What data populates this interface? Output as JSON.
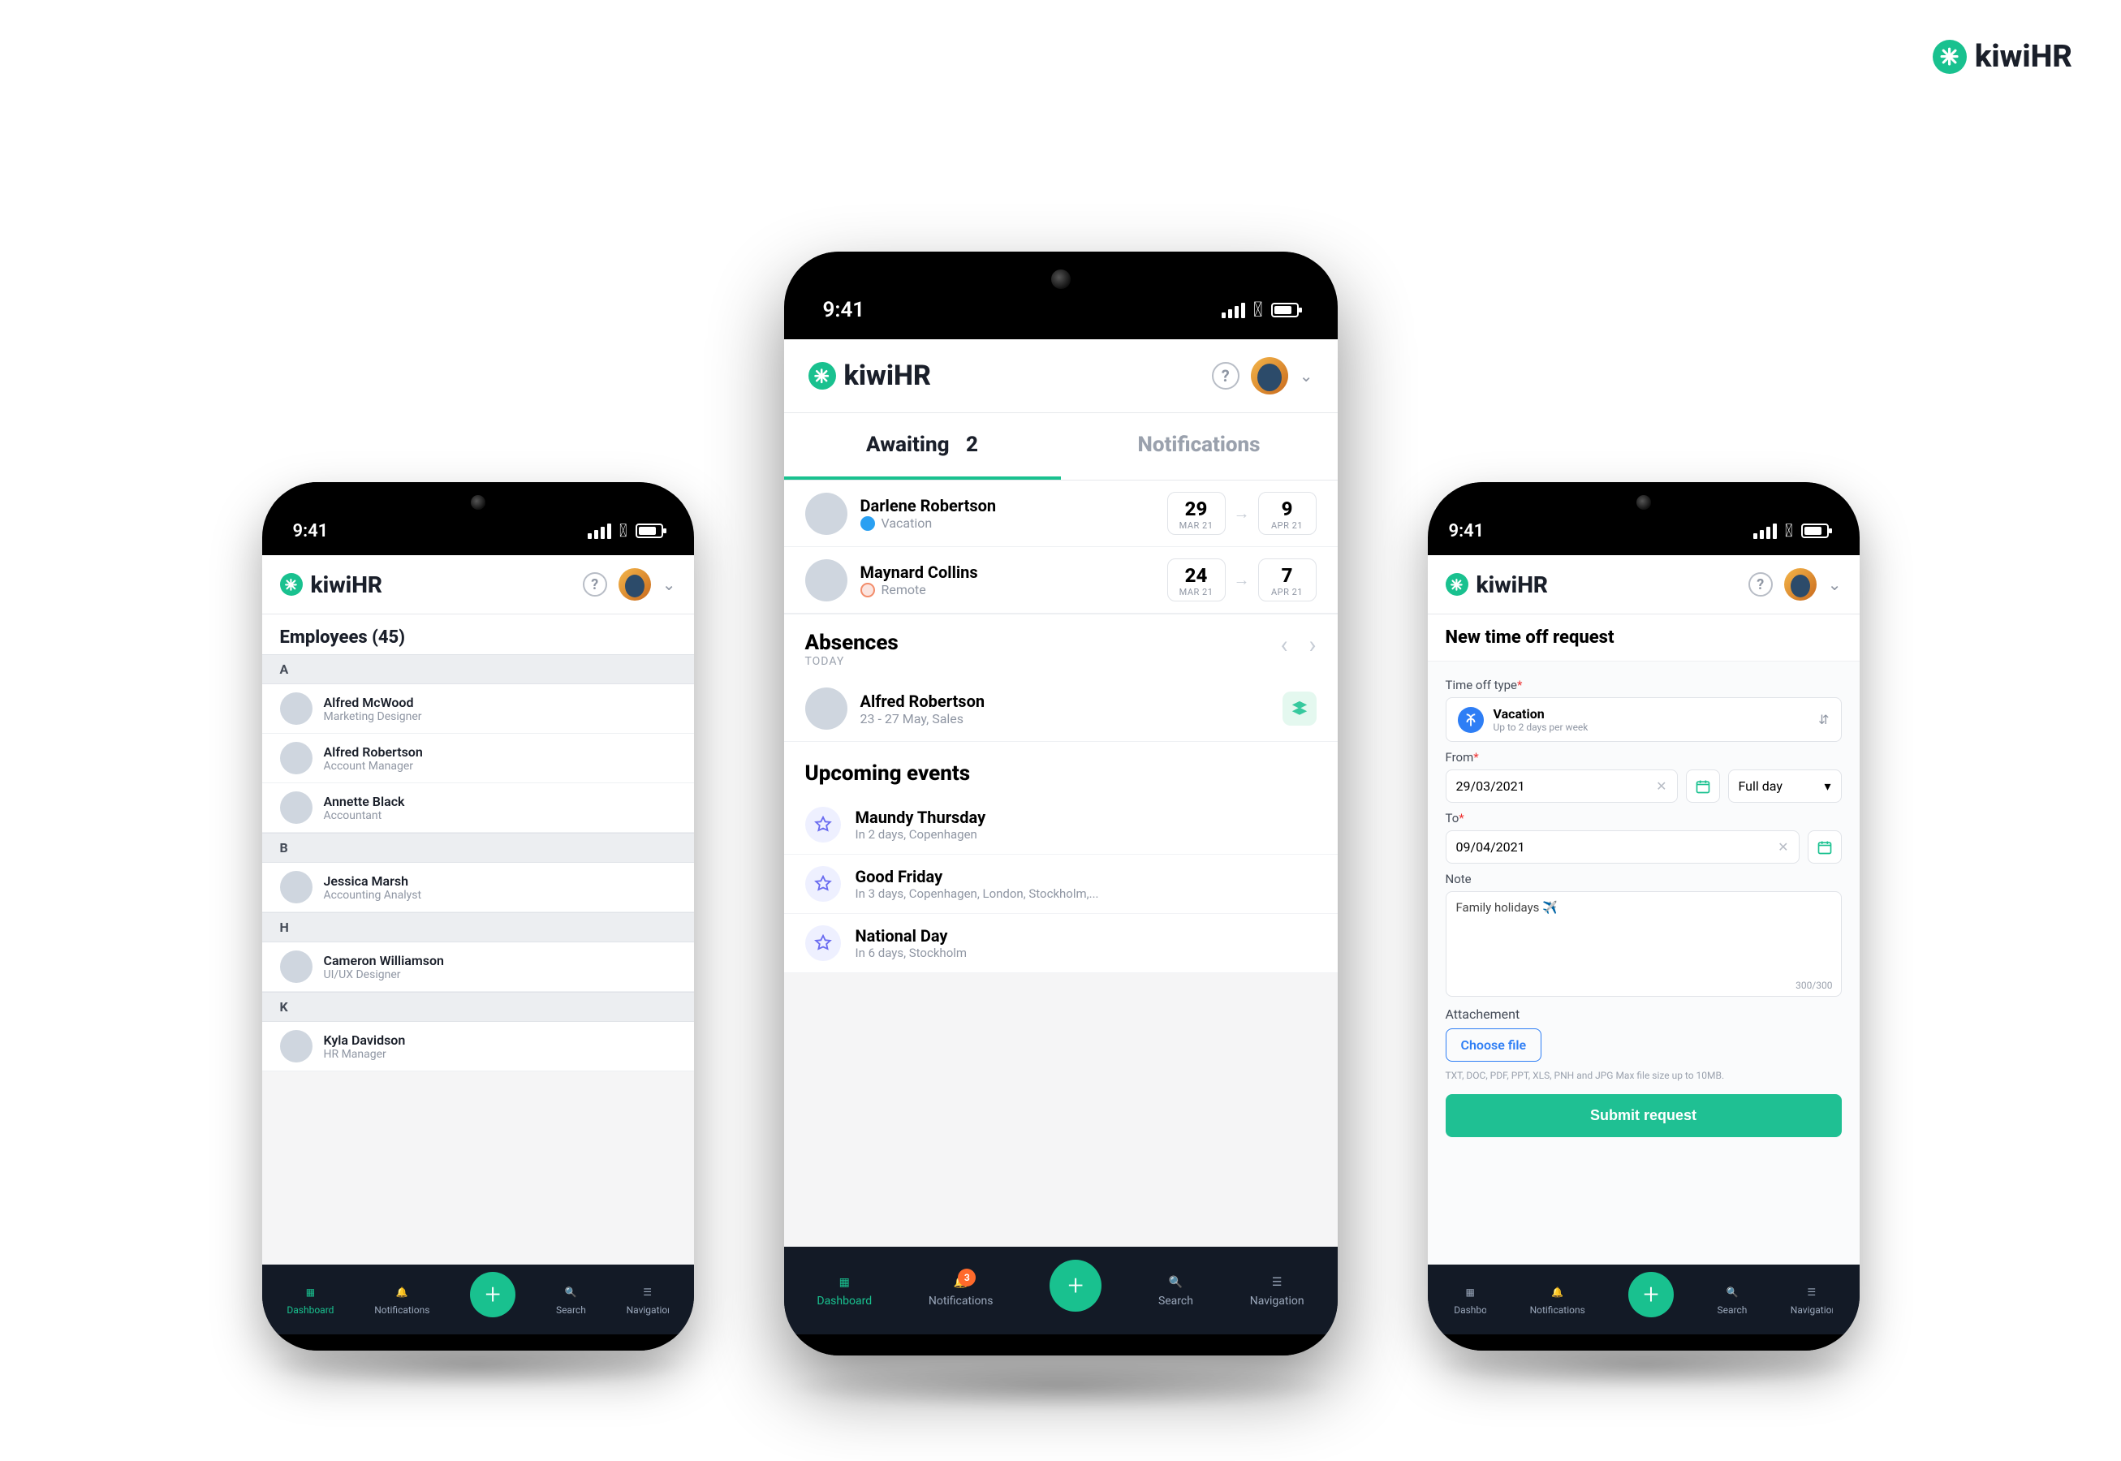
{
  "brand_name": "kiwiHR",
  "status_time": "9:41",
  "bottomnav": {
    "dashboard": "Dashboard",
    "notifications": "Notifications",
    "search": "Search",
    "navigation": "Navigation",
    "badge_count": "3"
  },
  "left": {
    "title": "Employees (45)",
    "groups": [
      {
        "letter": "A",
        "items": [
          {
            "name": "Alfred McWood",
            "role": "Marketing Designer"
          },
          {
            "name": "Alfred Robertson",
            "role": "Account Manager"
          },
          {
            "name": "Annette Black",
            "role": "Accountant"
          }
        ]
      },
      {
        "letter": "B",
        "items": [
          {
            "name": "Jessica Marsh",
            "role": "Accounting Analyst"
          }
        ]
      },
      {
        "letter": "H",
        "items": [
          {
            "name": "Cameron Williamson",
            "role": "UI/UX Designer"
          }
        ]
      },
      {
        "letter": "K",
        "items": [
          {
            "name": "Kyla Davidson",
            "role": "HR Manager"
          }
        ]
      }
    ]
  },
  "center": {
    "tab_awaiting": "Awaiting",
    "tab_awaiting_count": "2",
    "tab_notifications": "Notifications",
    "requests": [
      {
        "name": "Darlene Robertson",
        "type": "Vacation",
        "type_kind": "vac",
        "from_day": "29",
        "from_mon": "MAR 21",
        "to_day": "9",
        "to_mon": "APR 21"
      },
      {
        "name": "Maynard Collins",
        "type": "Remote",
        "type_kind": "rem",
        "from_day": "24",
        "from_mon": "MAR 21",
        "to_day": "7",
        "to_mon": "APR 21"
      }
    ],
    "absences_title": "Absences",
    "absences_sub": "TODAY",
    "absence": {
      "name": "Alfred Robertson",
      "detail": "23 - 27 May, Sales"
    },
    "events_title": "Upcoming events",
    "events": [
      {
        "name": "Maundy Thursday",
        "sub": "In 2 days, Copenhagen"
      },
      {
        "name": "Good Friday",
        "sub": "In 3 days, Copenhagen, London, Stockholm,..."
      },
      {
        "name": "National Day",
        "sub": "In 6 days, Stockholm"
      }
    ]
  },
  "right": {
    "page_title": "New time off request",
    "type_label": "Time off type",
    "type_value": "Vacation",
    "type_sub": "Up to 2 days per week",
    "from_label": "From",
    "from_value": "29/03/2021",
    "fullday": "Full day",
    "to_label": "To",
    "to_value": "09/04/2021",
    "note_label": "Note",
    "note_value": "Family holidays ✈️",
    "note_counter": "300/300",
    "attach_label": "Attachement",
    "choose_file": "Choose file",
    "hint": "TXT, DOC, PDF, PPT, XLS, PNH and JPG Max file size up to 10MB.",
    "submit": "Submit request"
  }
}
